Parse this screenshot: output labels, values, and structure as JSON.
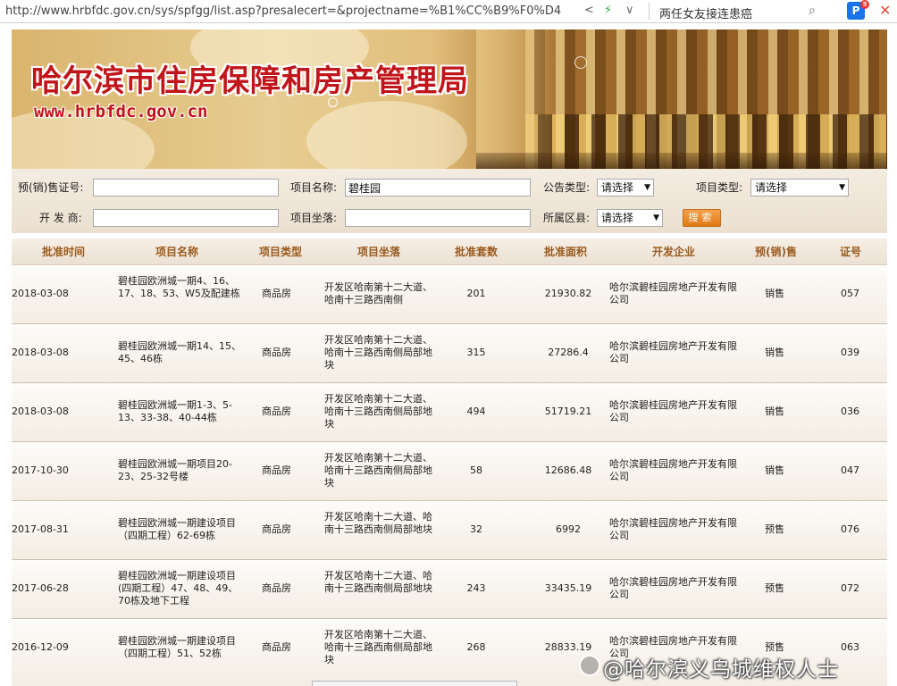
{
  "browser": {
    "url": "http://www.hrbfdc.gov.cn/sys/spfgg/list.asp?presalecert=&projectname=%B1%CC%B9%F0%D4",
    "hot_search": "两任女友接连患癌",
    "ext_badge": "5"
  },
  "banner": {
    "title": "哈尔滨市住房保障和房产管理局",
    "site": "www.hrbfdc.gov.cn"
  },
  "form": {
    "presale_label": "预(销)售证号:",
    "presale_value": "",
    "project_name_label": "项目名称:",
    "project_name_value": "碧桂园",
    "notice_type_label": "公告类型:",
    "notice_type_value": "请选择",
    "project_type_label": "项目类型:",
    "project_type_value": "请选择",
    "developer_label": "开 发 商:",
    "developer_value": "",
    "location_label": "项目坐落:",
    "location_value": "",
    "district_label": "所属区县:",
    "district_value": "请选择",
    "search_button": "搜索"
  },
  "table": {
    "headers": [
      "批准时间",
      "项目名称",
      "项目类型",
      "项目坐落",
      "批准套数",
      "批准面积",
      "开发企业",
      "预(销)售",
      "证号"
    ],
    "rows": [
      {
        "date": "2018-03-08",
        "name": "碧桂园欧洲城一期4、16、17、18、53、W5及配建栋",
        "type": "商品房",
        "location": "开发区哈南第十二大道、哈南十三路西南侧",
        "units": "201",
        "area": "21930.82",
        "developer": "哈尔滨碧桂园房地产开发有限公司",
        "sale": "销售",
        "cert": "057"
      },
      {
        "date": "2018-03-08",
        "name": "碧桂园欧洲城一期14、15、45、46栋",
        "type": "商品房",
        "location": "开发区哈南第十二大道、哈南十三路西南侧局部地块",
        "units": "315",
        "area": "27286.4",
        "developer": "哈尔滨碧桂园房地产开发有限公司",
        "sale": "销售",
        "cert": "039"
      },
      {
        "date": "2018-03-08",
        "name": "碧桂园欧洲城一期1-3、5-13、33-38、40-44栋",
        "type": "商品房",
        "location": "开发区哈南第十二大道、哈南十三路西南侧局部地块",
        "units": "494",
        "area": "51719.21",
        "developer": "哈尔滨碧桂园房地产开发有限公司",
        "sale": "销售",
        "cert": "036"
      },
      {
        "date": "2017-10-30",
        "name": "碧桂园欧洲城一期项目20-23、25-32号楼",
        "type": "商品房",
        "location": "开发区哈南第十二大道、哈南十三路西南侧局部地块",
        "units": "58",
        "area": "12686.48",
        "developer": "哈尔滨碧桂园房地产开发有限公司",
        "sale": "销售",
        "cert": "047"
      },
      {
        "date": "2017-08-31",
        "name": "碧桂园欧洲城一期建设项目（四期工程）62-69栋",
        "type": "商品房",
        "location": "开发区哈南十二大道、哈南十三路西南侧局部地块",
        "units": "32",
        "area": "6992",
        "developer": "哈尔滨碧桂园房地产开发有限公司",
        "sale": "预售",
        "cert": "076"
      },
      {
        "date": "2017-06-28",
        "name": "碧桂园欧洲城一期建设项目(四期工程）47、48、49、70栋及地下工程",
        "type": "商品房",
        "location": "开发区哈南十二大道、哈南十三路西南侧局部地块",
        "units": "243",
        "area": "33435.19",
        "developer": "哈尔滨碧桂园房地产开发有限公司",
        "sale": "预售",
        "cert": "072"
      },
      {
        "date": "2016-12-09",
        "name": "碧桂园欧洲城一期建设项目（四期工程）51、52栋",
        "type": "商品房",
        "location": "开发区哈南第十二大道、哈南十三路西南侧局部地块",
        "units": "268",
        "area": "28833.19",
        "developer": "哈尔滨碧桂园房地产开发有限公司",
        "sale": "预售",
        "cert": "063"
      }
    ]
  },
  "watermark": "@哈尔滨义乌城维权人士"
}
